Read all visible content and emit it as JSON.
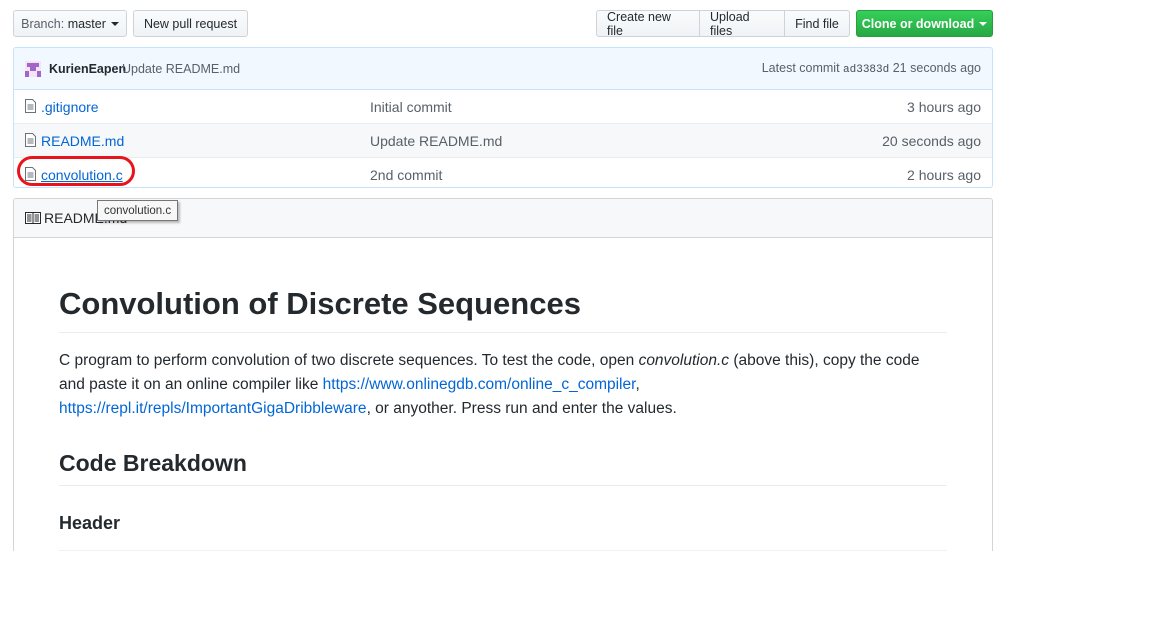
{
  "toolbar": {
    "branch_prefix": "Branch:",
    "branch_name": "master",
    "new_pull_request": "New pull request",
    "create_new_file": "Create new file",
    "upload_files": "Upload files",
    "find_file": "Find file",
    "clone_or_download": "Clone or download"
  },
  "commit_bar": {
    "author": "KurienEapen",
    "message": "Update README.md",
    "latest_label": "Latest commit",
    "sha": "ad3383d",
    "age": "21 seconds ago"
  },
  "files": [
    {
      "name": ".gitignore",
      "commit": "Initial commit",
      "age": "3 hours ago"
    },
    {
      "name": "README.md",
      "commit": "Update README.md",
      "age": "20 seconds ago"
    },
    {
      "name": "convolution.c",
      "commit": "2nd commit",
      "age": "2 hours ago"
    }
  ],
  "tooltip": "convolution.c",
  "readme": {
    "header_label": "README.md",
    "title": "Convolution of Discrete Sequences",
    "para_1": "C program to perform convolution of two discrete sequences. To test the code, open ",
    "para_em": "convolution.c",
    "para_2": " (above this), copy the code and paste it on an online compiler like ",
    "link_1": "https://www.onlinegdb.com/online_c_compiler",
    "para_3": ", ",
    "link_2": "https://repl.it/repls/ImportantGigaDribbleware",
    "para_4": ", or anyother. Press run and enter the values.",
    "h2": "Code Breakdown",
    "h3": "Header"
  },
  "colors": {
    "link": "#0366d6",
    "green_button": "#28a745",
    "highlight_ring": "#e8141b"
  }
}
